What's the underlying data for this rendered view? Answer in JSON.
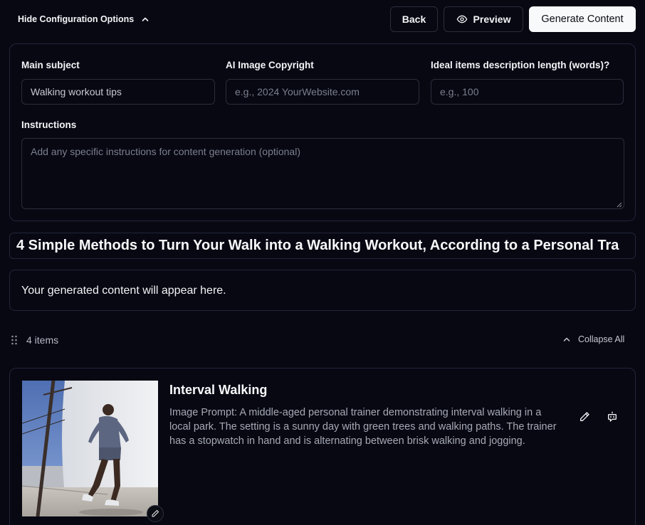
{
  "toolbar": {
    "toggle_label": "Hide Configuration Options",
    "back_label": "Back",
    "preview_label": "Preview",
    "generate_label": "Generate Content"
  },
  "config": {
    "main_subject": {
      "label": "Main subject",
      "value": "Walking workout tips",
      "placeholder": ""
    },
    "copyright": {
      "label": "AI Image Copyright",
      "value": "",
      "placeholder": "e.g., 2024 YourWebsite.com"
    },
    "desc_length": {
      "label": "Ideal items description length (words)?",
      "value": "",
      "placeholder": "e.g., 100"
    },
    "instructions": {
      "label": "Instructions",
      "value": "",
      "placeholder": "Add any specific instructions for content generation (optional)"
    }
  },
  "article": {
    "title": "4 Simple Methods to Turn Your Walk into a Walking Workout, According to a Personal Tra",
    "content_placeholder": "Your generated content will appear here."
  },
  "items_header": {
    "count_label": "4 items",
    "collapse_label": "Collapse All"
  },
  "items": [
    {
      "title": "Interval Walking",
      "description": "Image Prompt: A middle-aged personal trainer demonstrating interval walking in a local park. The setting is a sunny day with green trees and walking paths. The trainer has a stopwatch in hand and is alternating between brisk walking and jogging."
    }
  ],
  "icons": {
    "chevron_up": "chevron-up-icon",
    "eye": "eye-icon",
    "drag": "grip-vertical-icon",
    "pencil": "pencil-icon",
    "ai_chat": "bot-message-icon"
  },
  "colors": {
    "background": "#070812",
    "border": "#23263a",
    "primary_button": "#f8f9fb",
    "muted_text": "#a6a9b4"
  }
}
